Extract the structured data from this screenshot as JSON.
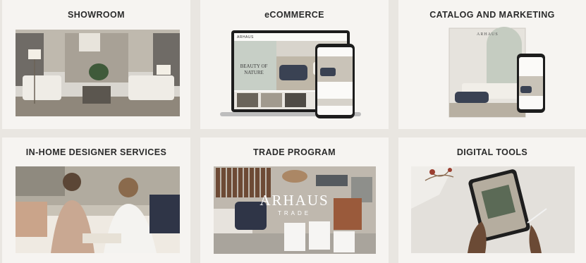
{
  "cards": [
    {
      "title": "SHOWROOM"
    },
    {
      "title": "eCOMMERCE"
    },
    {
      "title": "CATALOG AND MARKETING"
    },
    {
      "title": "IN-HOME DESIGNER SERVICES"
    },
    {
      "title": "TRADE PROGRAM"
    },
    {
      "title": "DIGITAL TOOLS"
    }
  ],
  "ecommerce": {
    "brand": "ARHAUS",
    "hero_text": "BEAUTY OF NATURE"
  },
  "catalog": {
    "brand": "ARHAUS"
  },
  "trade": {
    "brand": "ARHAUS",
    "sub": "TRADE"
  },
  "colors": {
    "background": "#e9e6e1",
    "card": "#f6f4f1",
    "title": "#2b2b2b"
  }
}
